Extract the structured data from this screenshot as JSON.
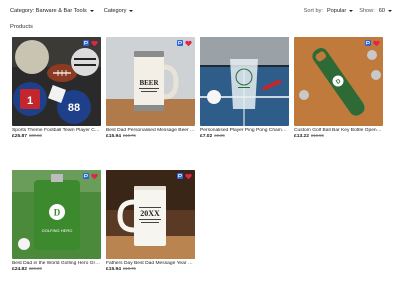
{
  "filters": {
    "category_label": "Category: Barware & Bar Tools",
    "category_dropdown": "Category",
    "sort_by_label": "Sort by:",
    "sort_value": "Popular",
    "show_label": "Show:",
    "show_value": "60"
  },
  "heading": "Products",
  "products": [
    {
      "title": "Sports Theme Football Team Player Coaster",
      "price": "£25.87",
      "was": "£30.83"
    },
    {
      "title": "Best Dad Personalised Message Beer Stein",
      "price": "£15.94",
      "was": "£18.75"
    },
    {
      "title": "Personalised Player Ping Pong Champion Glass",
      "price": "£7.02",
      "was": "£8.26"
    },
    {
      "title": "Custom Golf Ball Bar Key Bottle Opener Kit",
      "price": "£13.22",
      "was": "£15.55"
    },
    {
      "title": "Best Dad in the World Golfing Hero Green Flask",
      "price": "£24.82",
      "was": "£29.20"
    },
    {
      "title": "Fathers Day Best Dad Message Year Beer Stein",
      "price": "£15.94",
      "was": "£18.75"
    }
  ],
  "images": {
    "stein1_text": "BEER",
    "stein2_text": "20XX",
    "flask_letter": "D",
    "flask_text": "GOLFING HERO",
    "opener_letter": "D",
    "jersey_numbers": [
      "1",
      "88"
    ]
  },
  "colors": {
    "badge_blue": "#2b63d9",
    "heart_red": "#e0244a"
  },
  "icons": [
    "chevron-down-icon",
    "personalise-icon",
    "heart-icon"
  ]
}
